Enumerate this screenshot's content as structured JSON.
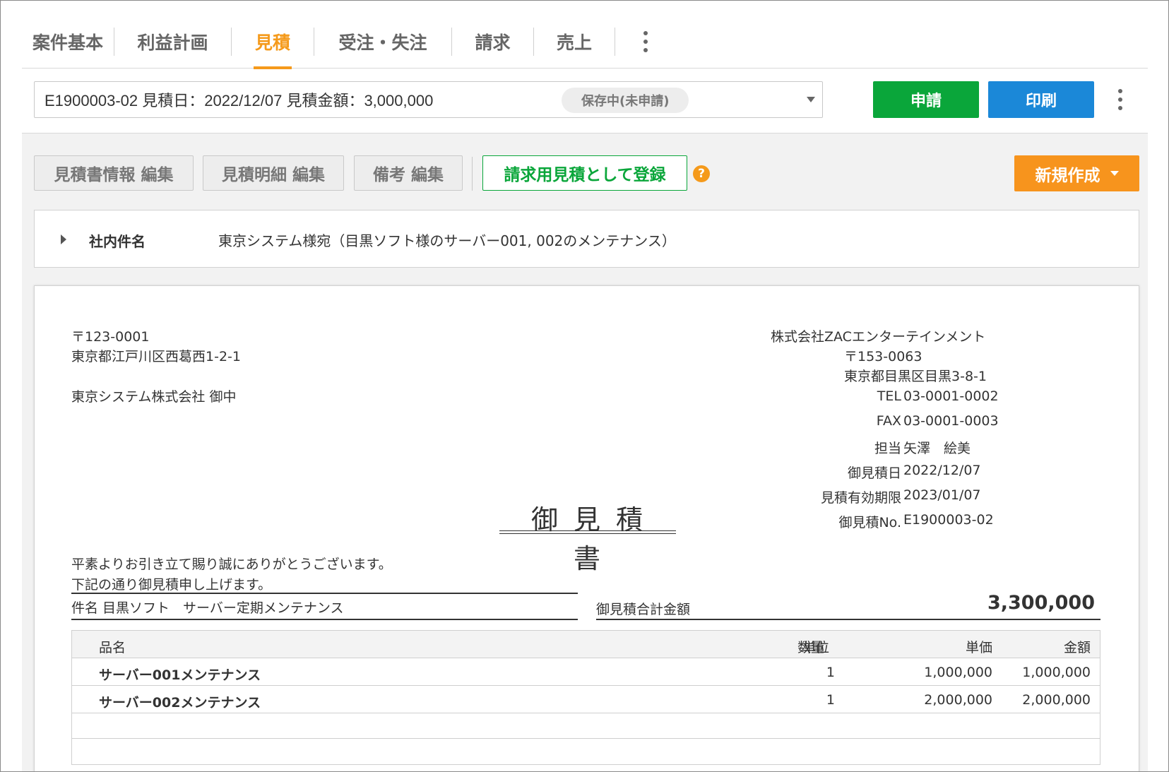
{
  "tabs": [
    {
      "label": "案件基本",
      "active": false
    },
    {
      "label": "利益計画",
      "active": false
    },
    {
      "label": "見積",
      "active": true
    },
    {
      "label": "受注・失注",
      "active": false
    },
    {
      "label": "請求",
      "active": false
    },
    {
      "label": "売上",
      "active": false
    }
  ],
  "selector": {
    "text": "E1900003-02 見積日：2022/12/07 見積金額：3,000,000",
    "status": "保存中(未申請)"
  },
  "actions": {
    "apply": "申請",
    "print": "印刷"
  },
  "toolbar": {
    "edit_info": "見積書情報 編集",
    "edit_details": "見積明細 編集",
    "edit_notes": "備考 編集",
    "register_billing": "請求用見積として登録",
    "help": "?",
    "new": "新規作成"
  },
  "internal": {
    "label": "社内件名",
    "value": "東京システム様宛（目黒ソフト様のサーバー001, 002のメンテナンス）"
  },
  "document": {
    "recipient": {
      "postal": "〒123-0001",
      "address": "東京都江戸川区西葛西1-2-1",
      "name": "東京システム株式会社 御中"
    },
    "sender": {
      "company": "株式会社ZACエンターテインメント",
      "postal": "〒153-0063",
      "address": "東京都目黒区目黒3-8-1",
      "fields": [
        {
          "label": "TEL",
          "value": "03-0001-0002"
        },
        {
          "label": "FAX",
          "value": "03-0001-0003"
        },
        {
          "label": "担当",
          "value": "矢澤　絵美"
        },
        {
          "label": "御見積日",
          "value": "2022/12/07"
        },
        {
          "label": "見積有効期限",
          "value": "2023/01/07"
        },
        {
          "label": "御見積No.",
          "value": "E1900003-02"
        }
      ]
    },
    "title": "御見積書",
    "greeting1": "平素よりお引き立て賜り誠にありがとうございます。",
    "greeting2": "下記の通り御見積申し上げます。",
    "subject": "件名  目黒ソフト　サーバー定期メンテナンス",
    "total_label": "御見積合計金額",
    "total_value": "3,300,000",
    "table": {
      "headers": {
        "name": "品名",
        "qty": "数量",
        "unit": "単位",
        "unit_price": "単価",
        "amount": "金額"
      },
      "rows": [
        {
          "name": "サーバー001メンテナンス",
          "qty": "1",
          "unit": "",
          "unit_price": "1,000,000",
          "amount": "1,000,000"
        },
        {
          "name": "サーバー002メンテナンス",
          "qty": "1",
          "unit": "",
          "unit_price": "2,000,000",
          "amount": "2,000,000"
        }
      ]
    }
  },
  "colors": {
    "accent_orange": "#f59a1b",
    "apply_green": "#0aa63a",
    "print_blue": "#1b88d8"
  }
}
